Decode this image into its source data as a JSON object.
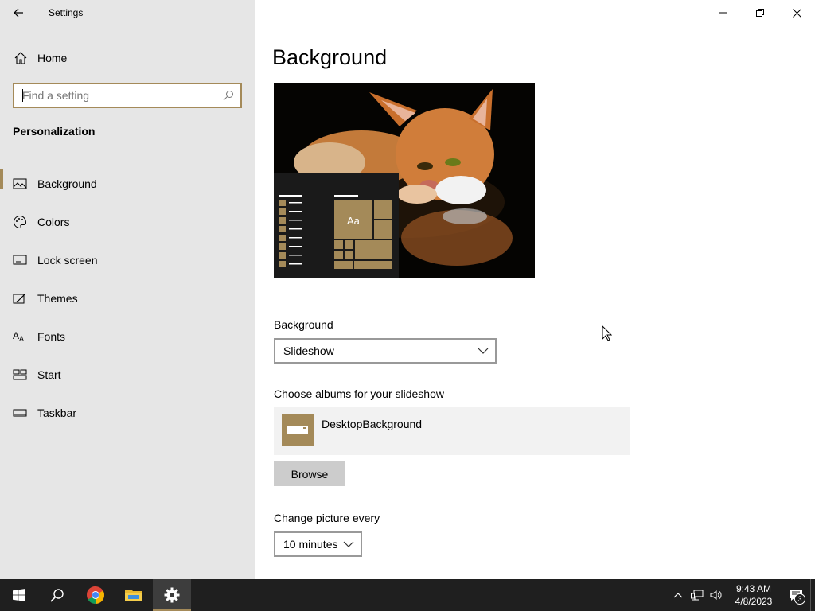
{
  "window": {
    "title": "Settings",
    "controls": [
      "minimize-icon",
      "restore-icon",
      "close-icon"
    ]
  },
  "sidebar": {
    "home_label": "Home",
    "search_placeholder": "Find a setting",
    "section_title": "Personalization",
    "items": [
      {
        "label": "Background",
        "icon": "picture-icon",
        "active": true
      },
      {
        "label": "Colors",
        "icon": "palette-icon",
        "active": false
      },
      {
        "label": "Lock screen",
        "icon": "lock-screen-icon",
        "active": false
      },
      {
        "label": "Themes",
        "icon": "themes-icon",
        "active": false
      },
      {
        "label": "Fonts",
        "icon": "fonts-icon",
        "active": false
      },
      {
        "label": "Start",
        "icon": "start-icon",
        "active": false
      },
      {
        "label": "Taskbar",
        "icon": "taskbar-icon",
        "active": false
      }
    ]
  },
  "main": {
    "page_title": "Background",
    "preview": {
      "tile_text": "Aa"
    },
    "background_label": "Background",
    "background_value": "Slideshow",
    "albums_label": "Choose albums for your slideshow",
    "album_name": "DesktopBackground",
    "browse_label": "Browse",
    "change_label": "Change picture every",
    "change_value": "10 minutes"
  },
  "taskbar": {
    "time": "9:43 AM",
    "date": "4/8/2023",
    "notification_count": "3"
  },
  "colors": {
    "accent": "#a48a59",
    "sidebar_bg": "#e6e6e6",
    "taskbar_bg": "#1f1f1f"
  }
}
